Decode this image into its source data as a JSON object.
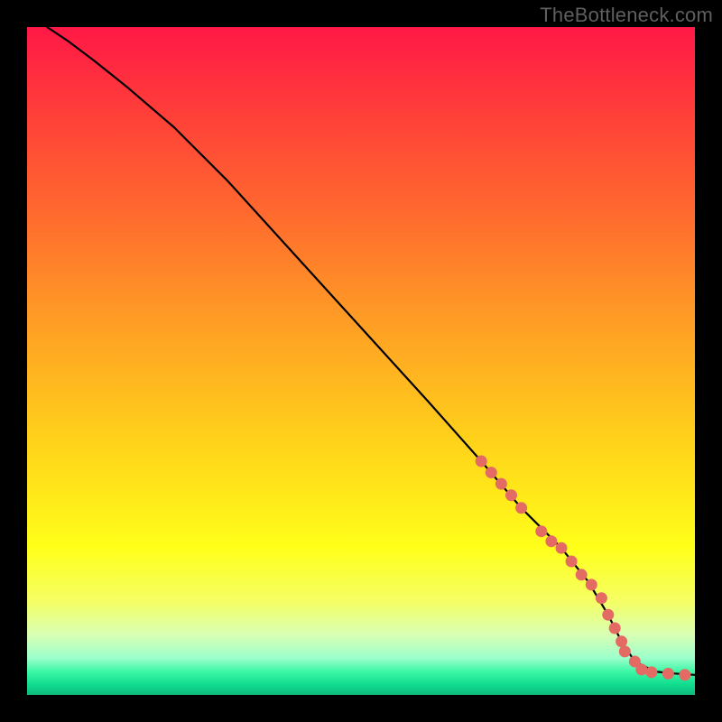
{
  "watermark": "TheBottleneck.com",
  "chart_data": {
    "type": "line",
    "title": "",
    "xlabel": "",
    "ylabel": "",
    "xlim": [
      0,
      100
    ],
    "ylim": [
      0,
      100
    ],
    "background_gradient_stops": [
      {
        "offset": 0.0,
        "color": "#ff1846"
      },
      {
        "offset": 0.12,
        "color": "#ff3c3a"
      },
      {
        "offset": 0.28,
        "color": "#ff6a2e"
      },
      {
        "offset": 0.45,
        "color": "#ffa024"
      },
      {
        "offset": 0.62,
        "color": "#ffd21a"
      },
      {
        "offset": 0.78,
        "color": "#ffff1a"
      },
      {
        "offset": 0.86,
        "color": "#f5ff64"
      },
      {
        "offset": 0.91,
        "color": "#d8ffb4"
      },
      {
        "offset": 0.945,
        "color": "#9cffcc"
      },
      {
        "offset": 0.965,
        "color": "#3cf7a6"
      },
      {
        "offset": 0.985,
        "color": "#10dc8e"
      },
      {
        "offset": 1.0,
        "color": "#0fb87a"
      }
    ],
    "series": [
      {
        "name": "curve",
        "type": "line",
        "color": "#000000",
        "x": [
          3,
          6,
          10,
          15,
          22,
          30,
          40,
          50,
          60,
          68,
          74,
          80,
          84,
          87,
          89,
          91,
          94,
          97,
          100
        ],
        "y": [
          100,
          98,
          95,
          91,
          85,
          77,
          66,
          55,
          44,
          35,
          28,
          22,
          17,
          12,
          8,
          5,
          3.5,
          3.2,
          3
        ]
      },
      {
        "name": "highlight-points",
        "type": "scatter",
        "color": "#e46a64",
        "radius": 6.5,
        "x": [
          68,
          69.5,
          71,
          72.5,
          74,
          77,
          78.5,
          80,
          81.5,
          83,
          84.5,
          86,
          87,
          88,
          89,
          89.5,
          91,
          92,
          93.5,
          96,
          98.5
        ],
        "y": [
          35,
          33.3,
          31.6,
          29.9,
          28,
          24.5,
          23,
          22,
          20,
          18,
          16.5,
          14.5,
          12,
          10,
          8,
          6.5,
          5,
          3.8,
          3.4,
          3.2,
          3
        ]
      }
    ]
  }
}
